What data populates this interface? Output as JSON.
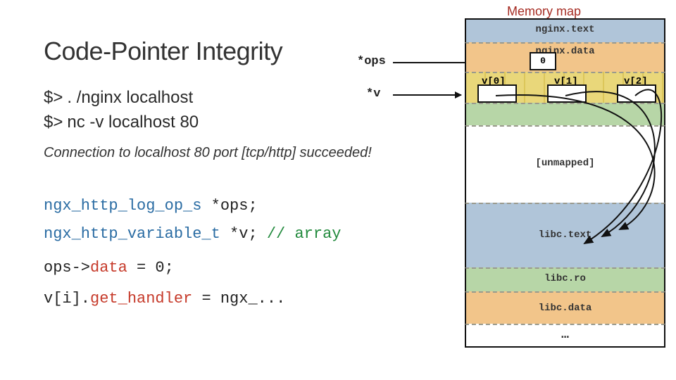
{
  "title": "Code-Pointer Integrity",
  "cmd1_prompt": "$>",
  "cmd1_text": ". /nginx localhost",
  "cmd2_prompt": "$>",
  "cmd2_text": "nc -v localhost 80",
  "output": "Connection to localhost 80 port [tcp/http] succeeded!",
  "code1_a": "ngx_http_log_op_s",
  "code1_b": " *ops;",
  "code2_a": "ngx_http_variable_t",
  "code2_b": " *v; ",
  "code2_c": "// array",
  "code3_a": "ops->",
  "code3_b": "data",
  "code3_c": " = 0;",
  "code4_a": "v[i].",
  "code4_b": "get_handler",
  "code4_c": " = ngx_...",
  "ptr_ops": "*ops",
  "ptr_v": "*v",
  "mem_title": "Memory map",
  "regions": {
    "nginx_text": "nginx.text",
    "nginx_data": "nginx.data",
    "unmapped": "[unmapped]",
    "libc_text": "libc.text",
    "libc_ro": "libc.ro",
    "libc_data": "libc.data",
    "dots": "…"
  },
  "data_box": "0",
  "v0": "v[0]",
  "v1": "v[1]",
  "v2": "v[2]"
}
